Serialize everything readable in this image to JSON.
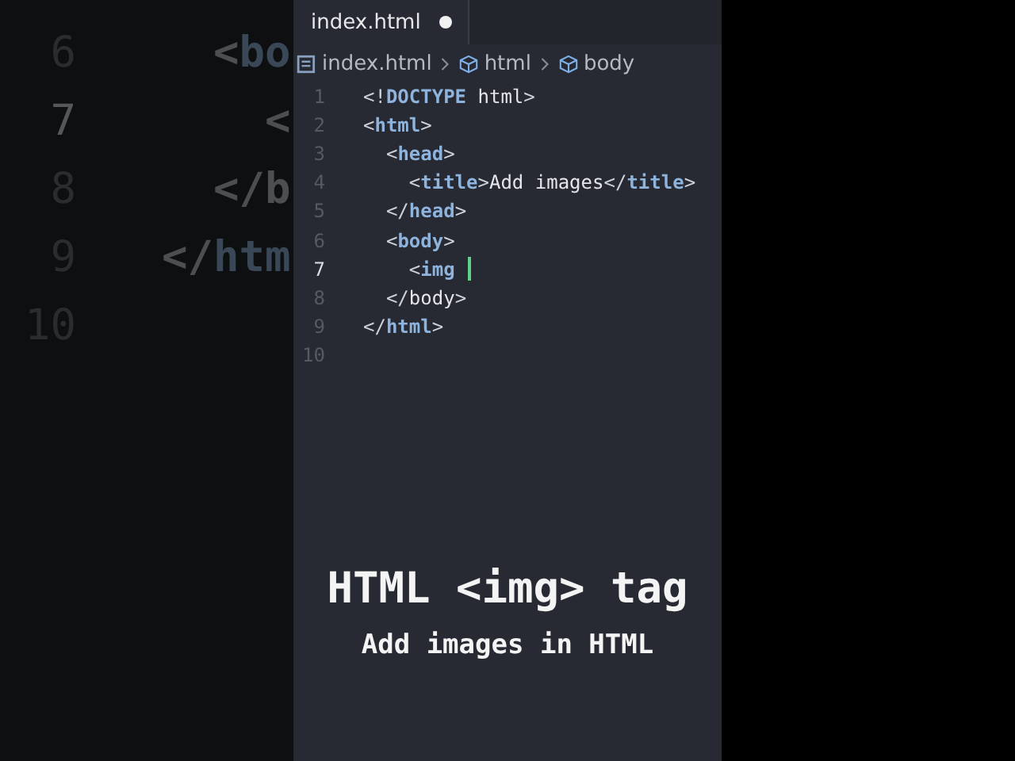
{
  "background_code": [
    {
      "number": "6",
      "current": false,
      "tokens": [
        {
          "kind": "punct",
          "text": "  <"
        },
        {
          "kind": "tag",
          "text": "bo"
        }
      ]
    },
    {
      "number": "7",
      "current": true,
      "tokens": [
        {
          "kind": "punct",
          "text": "    <"
        }
      ]
    },
    {
      "number": "8",
      "current": false,
      "tokens": [
        {
          "kind": "punct",
          "text": "  </"
        },
        {
          "kind": "plain",
          "text": "b"
        }
      ]
    },
    {
      "number": "9",
      "current": false,
      "tokens": [
        {
          "kind": "punct",
          "text": "</"
        },
        {
          "kind": "tag",
          "text": "htm"
        }
      ]
    },
    {
      "number": "10",
      "current": false
    }
  ],
  "tab": {
    "label": "index.html",
    "modified": true
  },
  "breadcrumb": [
    "index.html",
    "html",
    "body"
  ],
  "code": [
    {
      "number": "1",
      "current": false,
      "tokens": [
        {
          "kind": "punct",
          "text": "<!"
        },
        {
          "kind": "tag",
          "text": "DOCTYPE"
        },
        {
          "kind": "plain",
          "text": " html"
        },
        {
          "kind": "punct",
          "text": ">"
        }
      ]
    },
    {
      "number": "2",
      "current": false,
      "tokens": [
        {
          "kind": "punct",
          "text": "<"
        },
        {
          "kind": "tag",
          "text": "html"
        },
        {
          "kind": "punct",
          "text": ">"
        }
      ]
    },
    {
      "number": "3",
      "current": false,
      "tokens": [
        {
          "kind": "punct",
          "text": "  <"
        },
        {
          "kind": "tag",
          "text": "head"
        },
        {
          "kind": "punct",
          "text": ">"
        }
      ]
    },
    {
      "number": "4",
      "current": false,
      "tokens": [
        {
          "kind": "punct",
          "text": "    <"
        },
        {
          "kind": "tag",
          "text": "title"
        },
        {
          "kind": "punct",
          "text": ">"
        },
        {
          "kind": "plain",
          "text": "Add images"
        },
        {
          "kind": "punct",
          "text": "</"
        },
        {
          "kind": "tag",
          "text": "title"
        },
        {
          "kind": "punct",
          "text": ">"
        }
      ]
    },
    {
      "number": "5",
      "current": false,
      "tokens": [
        {
          "kind": "punct",
          "text": "  </"
        },
        {
          "kind": "tag",
          "text": "head"
        },
        {
          "kind": "punct",
          "text": ">"
        }
      ]
    },
    {
      "number": "6",
      "current": false,
      "tokens": [
        {
          "kind": "punct",
          "text": "  <"
        },
        {
          "kind": "tag",
          "text": "body"
        },
        {
          "kind": "punct",
          "text": ">"
        }
      ]
    },
    {
      "number": "7",
      "current": true,
      "tokens": [
        {
          "kind": "punct",
          "text": "    <"
        },
        {
          "kind": "tag",
          "text": "img"
        }
      ]
    },
    {
      "number": "8",
      "current": false,
      "tokens": [
        {
          "kind": "punct",
          "text": "  </"
        },
        {
          "kind": "plain",
          "text": "body"
        },
        {
          "kind": "punct",
          "text": ">"
        }
      ]
    },
    {
      "number": "9",
      "current": false,
      "tokens": [
        {
          "kind": "punct",
          "text": "</"
        },
        {
          "kind": "tag",
          "text": "html"
        },
        {
          "kind": "punct",
          "text": ">"
        }
      ]
    },
    {
      "number": "10",
      "current": false
    }
  ],
  "caption": {
    "title": "HTML <img> tag",
    "subtitle": "Add images in HTML"
  }
}
